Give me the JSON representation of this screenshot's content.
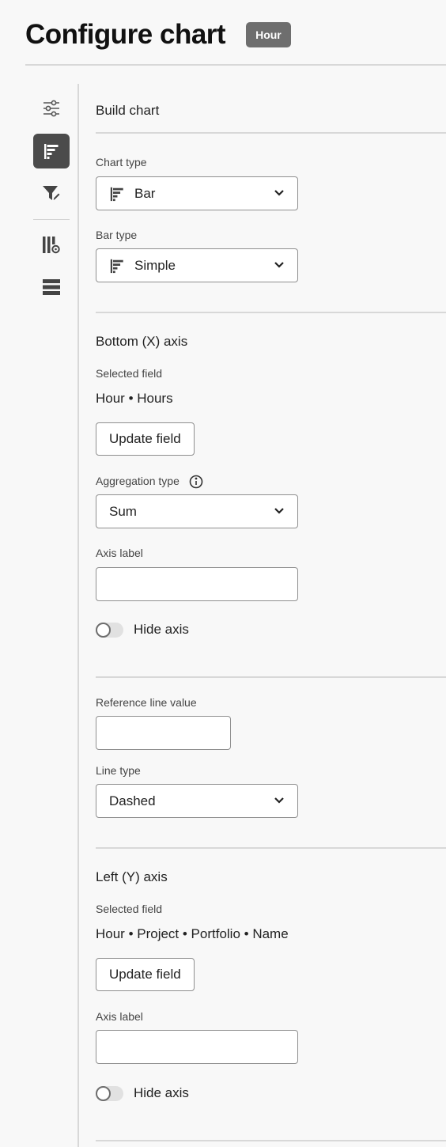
{
  "header": {
    "title": "Configure chart",
    "badge": "Hour"
  },
  "rail": {
    "items": [
      {
        "icon": "sliders-icon",
        "active": false
      },
      {
        "icon": "bar-chart-icon",
        "active": true
      },
      {
        "icon": "filter-edit-icon",
        "active": false
      },
      {
        "icon": "column-settings-icon",
        "active": false
      },
      {
        "icon": "list-rows-icon",
        "active": false
      }
    ]
  },
  "build": {
    "title": "Build chart",
    "chart_type_label": "Chart type",
    "chart_type_value": "Bar",
    "bar_type_label": "Bar type",
    "bar_type_value": "Simple"
  },
  "x_axis": {
    "title": "Bottom (X) axis",
    "selected_field_label": "Selected field",
    "selected_field_value": "Hour • Hours",
    "update_button": "Update field",
    "aggregation_label": "Aggregation type",
    "aggregation_value": "Sum",
    "axis_label_label": "Axis label",
    "axis_label_value": "",
    "hide_axis": "Hide axis",
    "hide_axis_on": false
  },
  "reference": {
    "value_label": "Reference line value",
    "value": "",
    "line_type_label": "Line type",
    "line_type_value": "Dashed"
  },
  "y_axis": {
    "title": "Left (Y) axis",
    "selected_field_label": "Selected field",
    "selected_field_value": "Hour • Project • Portfolio • Name",
    "update_button": "Update field",
    "axis_label_label": "Axis label",
    "axis_label_value": "",
    "hide_axis": "Hide axis",
    "hide_axis_on": false
  },
  "colors": {
    "active_rail": "#4b4b4b",
    "badge": "#6e6e6e",
    "border": "#8f8f8f",
    "rule": "#d8d8d8"
  }
}
